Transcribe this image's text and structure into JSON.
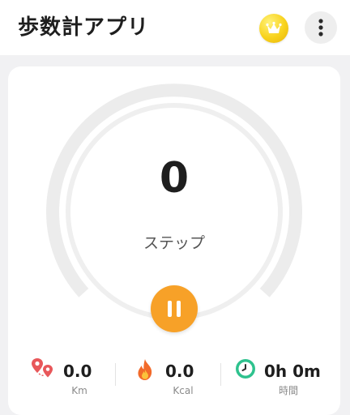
{
  "app_bar": {
    "title": "歩数計アプリ",
    "premium_icon": "crown-icon",
    "more_icon": "more-vertical-icon"
  },
  "tracker": {
    "steps": "0",
    "steps_label": "ステップ",
    "progress": 0,
    "control_icon": "pause-icon"
  },
  "stats": [
    {
      "icon": "map-pins-icon",
      "value": "0.0",
      "unit": "Km"
    },
    {
      "icon": "flame-icon",
      "value": "0.0",
      "unit": "Kcal"
    },
    {
      "icon": "timer-icon",
      "value": "0h 0m",
      "unit": "時間"
    }
  ],
  "colors": {
    "accent": "#f7a128",
    "ring_track": "#ececec",
    "premium_gold": "#f8d21c",
    "timer_green": "#2ec28e",
    "pin_red": "#e8575a",
    "flame_orange": "#f26a2a"
  }
}
